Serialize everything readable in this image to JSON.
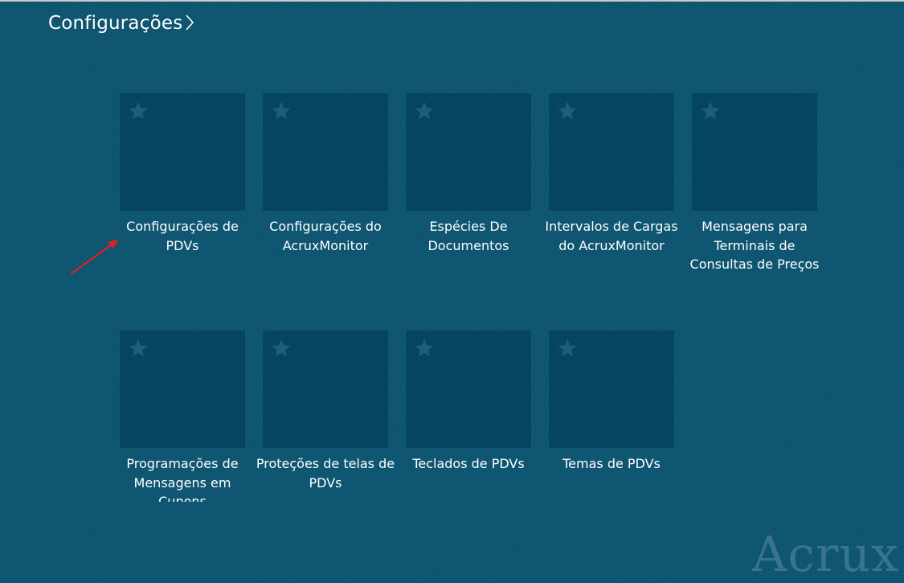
{
  "header": {
    "title": "Configurações"
  },
  "tiles": [
    {
      "label": "Configurações de PDVs"
    },
    {
      "label": "Configurações do AcruxMonitor"
    },
    {
      "label": "Espécies De Documentos"
    },
    {
      "label": "Intervalos de Cargas do AcruxMonitor"
    },
    {
      "label": "Mensagens para Terminais de Consultas de Preços"
    },
    {
      "label": "Programações de Mensagens em Cupons"
    },
    {
      "label": "Proteções de telas de PDVs"
    },
    {
      "label": "Teclados de PDVs"
    },
    {
      "label": "Temas de PDVs"
    }
  ],
  "brand": {
    "text": "Acrux"
  },
  "colors": {
    "background": "#0d5571",
    "tile": "#054560",
    "star": "#235c76",
    "annotation_arrow": "#e02020"
  },
  "icons": {
    "tile_star": "star-icon",
    "header_chevron": "chevron-right-icon",
    "annotation": "red-arrow-annotation"
  }
}
